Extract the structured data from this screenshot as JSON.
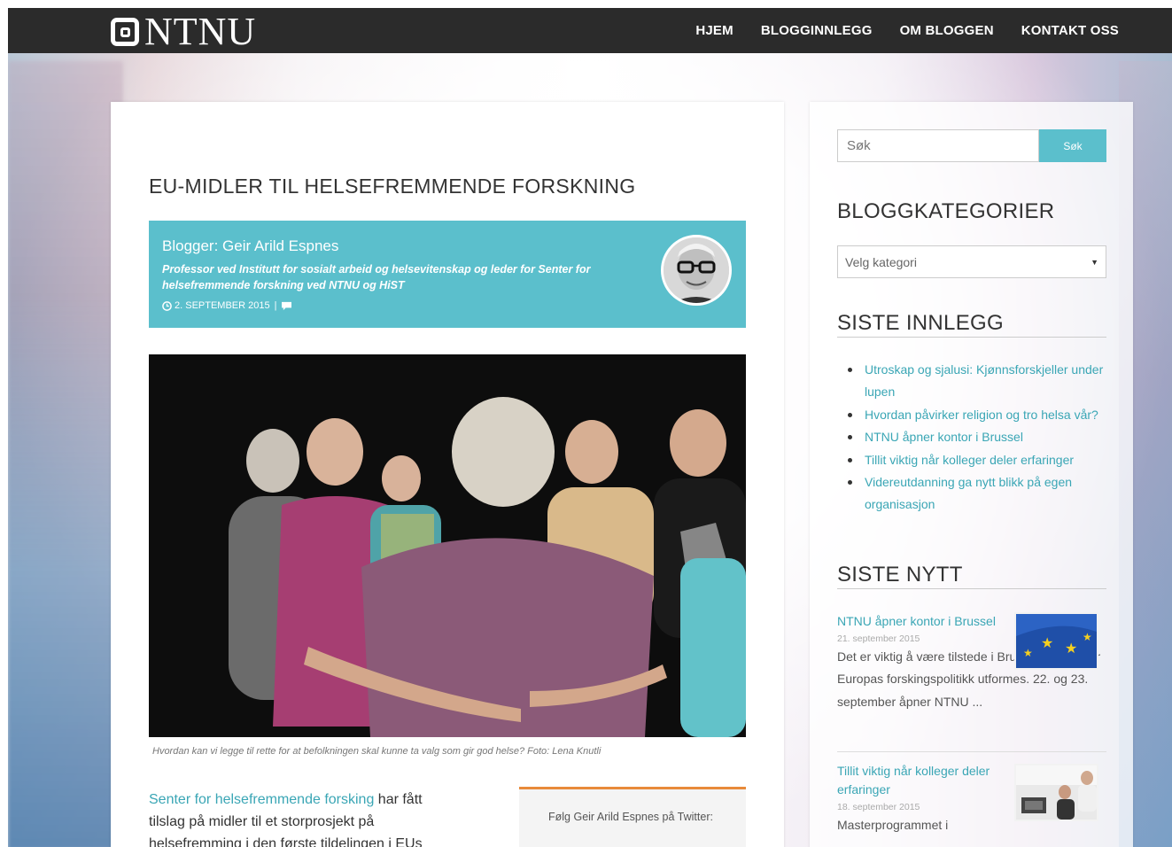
{
  "site": {
    "logo_text": "NTNU"
  },
  "nav": {
    "items": [
      "HJEM",
      "BLOGGINNLEGG",
      "OM BLOGGEN",
      "KONTAKT OSS"
    ]
  },
  "post": {
    "title": "EU-MIDLER TIL HELSEFREMMENDE FORSKNING",
    "author": {
      "name": "Blogger: Geir Arild Espnes",
      "description": "Professor ved Institutt for sosialt arbeid og helsevitenskap og leder for Senter for helsefremmende forskning ved NTNU og HiST",
      "date": "2. SEPTEMBER 2015",
      "separator": "|"
    },
    "caption": "Hvordan kan vi legge til rette for at befolkningen skal kunne ta valg som gir god helse? Foto: Lena Knutli",
    "body_link": "Senter for helsefremmende forsking",
    "body_rest": " har fått tilslag på midler til et storprosjekt på helsefremming i den første tildelingen i EUs",
    "twitter_label": "Følg Geir Arild Espnes på Twitter:"
  },
  "sidebar": {
    "search": {
      "placeholder": "Søk",
      "button": "Søk"
    },
    "categories": {
      "title": "BLOGGKATEGORIER",
      "select": "Velg kategori"
    },
    "recent": {
      "title": "SISTE INNLEGG",
      "items": [
        "Utroskap og sjalusi: Kjønnsforskjeller under lupen",
        "Hvordan påvirker religion og tro helsa vår?",
        "NTNU åpner kontor i Brussel",
        "Tillit viktig når kolleger deler erfaringer",
        "Videreutdanning ga nytt blikk på egen organisasjon"
      ]
    },
    "news": {
      "title": "SISTE NYTT",
      "items": [
        {
          "title": "NTNU åpner kontor i Brussel",
          "date": "21. september 2015",
          "excerpt": "Det er viktig å være tilstede i Brussel. Det er der Europas forskingspolitikk utformes. 22. og 23. september åpner NTNU ..."
        },
        {
          "title": "Tillit viktig når kolleger deler erfaringer",
          "date": "18. september 2015",
          "excerpt": "Masterprogrammet i"
        }
      ]
    }
  }
}
